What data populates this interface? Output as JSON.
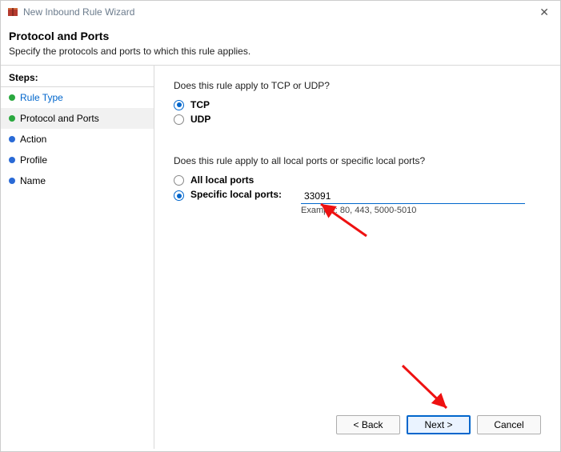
{
  "titlebar": {
    "title": "New Inbound Rule Wizard"
  },
  "header": {
    "heading": "Protocol and Ports",
    "subheading": "Specify the protocols and ports to which this rule applies."
  },
  "sidebar": {
    "label": "Steps:",
    "items": [
      {
        "label": "Rule Type",
        "state": "done"
      },
      {
        "label": "Protocol and Ports",
        "state": "selected"
      },
      {
        "label": "Action",
        "state": "pending"
      },
      {
        "label": "Profile",
        "state": "pending"
      },
      {
        "label": "Name",
        "state": "pending"
      }
    ]
  },
  "main": {
    "q1": "Does this rule apply to TCP or UDP?",
    "proto": {
      "tcp": {
        "label": "TCP",
        "checked": true
      },
      "udp": {
        "label": "UDP",
        "checked": false
      }
    },
    "q2": "Does this rule apply to all local ports or specific local ports?",
    "portmode": {
      "all": {
        "label": "All local ports",
        "checked": false
      },
      "specific": {
        "label": "Specific local ports:",
        "checked": true
      }
    },
    "port_value": "33091",
    "example": "Example: 80, 443, 5000-5010"
  },
  "buttons": {
    "back": "< Back",
    "next": "Next >",
    "cancel": "Cancel"
  }
}
